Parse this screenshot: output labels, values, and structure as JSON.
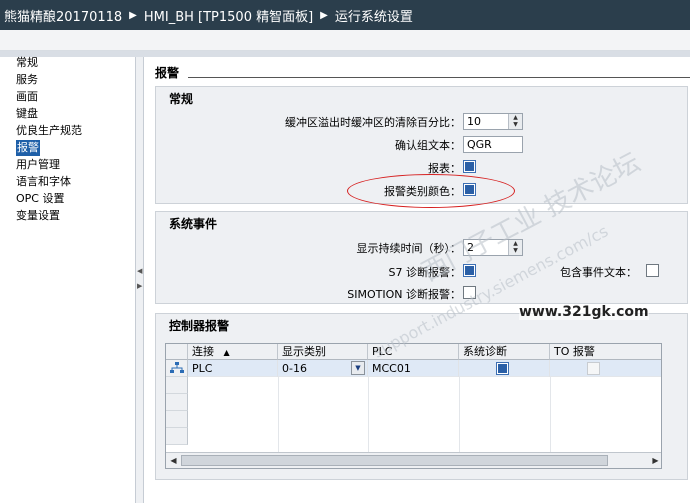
{
  "breadcrumb": {
    "project": "熊猫精酿20170118",
    "device": "HMI_BH [TP1500 精智面板]",
    "page": "运行系统设置"
  },
  "nav": {
    "items": [
      {
        "label": "常规"
      },
      {
        "label": "服务"
      },
      {
        "label": "画面"
      },
      {
        "label": "键盘"
      },
      {
        "label": "优良生产规范"
      },
      {
        "label": "报警"
      },
      {
        "label": "用户管理"
      },
      {
        "label": "语言和字体"
      },
      {
        "label": "OPC 设置"
      },
      {
        "label": "变量设置"
      }
    ],
    "active_label": "报警"
  },
  "page": {
    "title": "报警"
  },
  "general": {
    "title": "常规",
    "overflow_label": "缓冲区溢出时缓冲区的清除百分比：",
    "overflow_value": "10",
    "ack_label": "确认组文本：",
    "ack_value": "QGR",
    "report_label": "报表：",
    "class_color_label": "报警类别颜色："
  },
  "system_events": {
    "title": "系统事件",
    "duration_label": "显示持续时间（秒）：",
    "duration_value": "2",
    "s7_label": "S7 诊断报警：",
    "simotion_label": "SIMOTION 诊断报警：",
    "include_label": "包含事件文本："
  },
  "controller_alarms": {
    "title": "控制器报警",
    "columns": {
      "connection": "连接",
      "sort_arrow": "▲",
      "display_class": "显示类别",
      "plc": "PLC",
      "sys_diag": "系统诊断",
      "to_alarm": "TO 报警"
    },
    "rows": [
      {
        "connection": "PLC",
        "display_class": "0-16",
        "plc": "MCC01",
        "sys_diag": true,
        "to_alarm": false
      }
    ]
  },
  "watermark": {
    "site": "www.321gk.com",
    "forum": "西门子工业  技术论坛",
    "support": "support.industry.siemens.com/cs"
  }
}
